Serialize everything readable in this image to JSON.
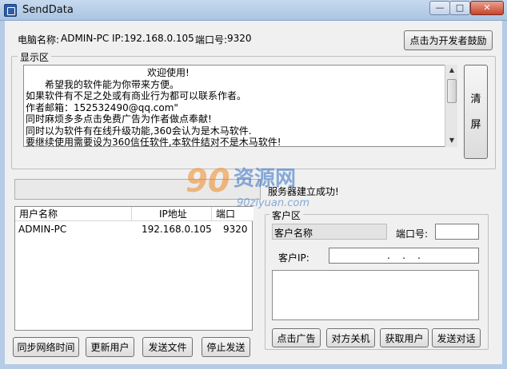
{
  "window": {
    "title": "SendData",
    "controls": {
      "minimize": "—",
      "maximize": "□",
      "close": "✕"
    }
  },
  "info": {
    "computer_name_label": "电脑名称:",
    "computer_name": "ADMIN-PC",
    "ip_label": "IP:",
    "ip": "192.168.0.105",
    "port_label": "端口号:",
    "port": "9320"
  },
  "toolbar": {
    "donate_button": "点击为开发者鼓励"
  },
  "display": {
    "group_title": "显示区",
    "lines": [
      "欢迎使用!",
      "希望我的软件能为你带来方便。",
      "如果软件有不足之处或有商业行为都可以联系作者。",
      "作者邮箱：152532490@qq.com\"",
      "同时麻烦多多点击免费广告为作者做点奉献!",
      "同时以为软件有在线升级功能,360会认为是木马软件.",
      "要继续使用需要设为360信任软件,本软件结对不是木马软件!"
    ],
    "clear_button_top": "清",
    "clear_button_bottom": "屏"
  },
  "status": {
    "text": "服务器建立成功!"
  },
  "watermark": {
    "number": "90",
    "brand": "资源网",
    "url": "90ziyuan.com"
  },
  "user_list": {
    "columns": [
      "用户名称",
      "IP地址",
      "端口"
    ],
    "rows": [
      {
        "name": "ADMIN-PC",
        "ip": "192.168.0.105",
        "port": "9320"
      }
    ]
  },
  "client": {
    "group_title": "客户区",
    "name_label": "客户名称",
    "port_label": "端口号:",
    "port_value": "",
    "ip_label": "客户IP:",
    "ip_value": "   .    .    .   ",
    "message": ""
  },
  "bottom_buttons": {
    "sync_time": "同步网络时间",
    "refresh_users": "更新用户",
    "send_file": "发送文件",
    "stop_send": "停止发送"
  },
  "client_buttons": {
    "ad": "点击广告",
    "shutdown": "对方关机",
    "get_user": "获取用户",
    "send_chat": "发送对话"
  },
  "colors": {
    "titlebar": "#aac4e2",
    "close_button": "#c8442c",
    "watermark_blue": "#2f6fc6",
    "watermark_orange": "#f08a24"
  }
}
